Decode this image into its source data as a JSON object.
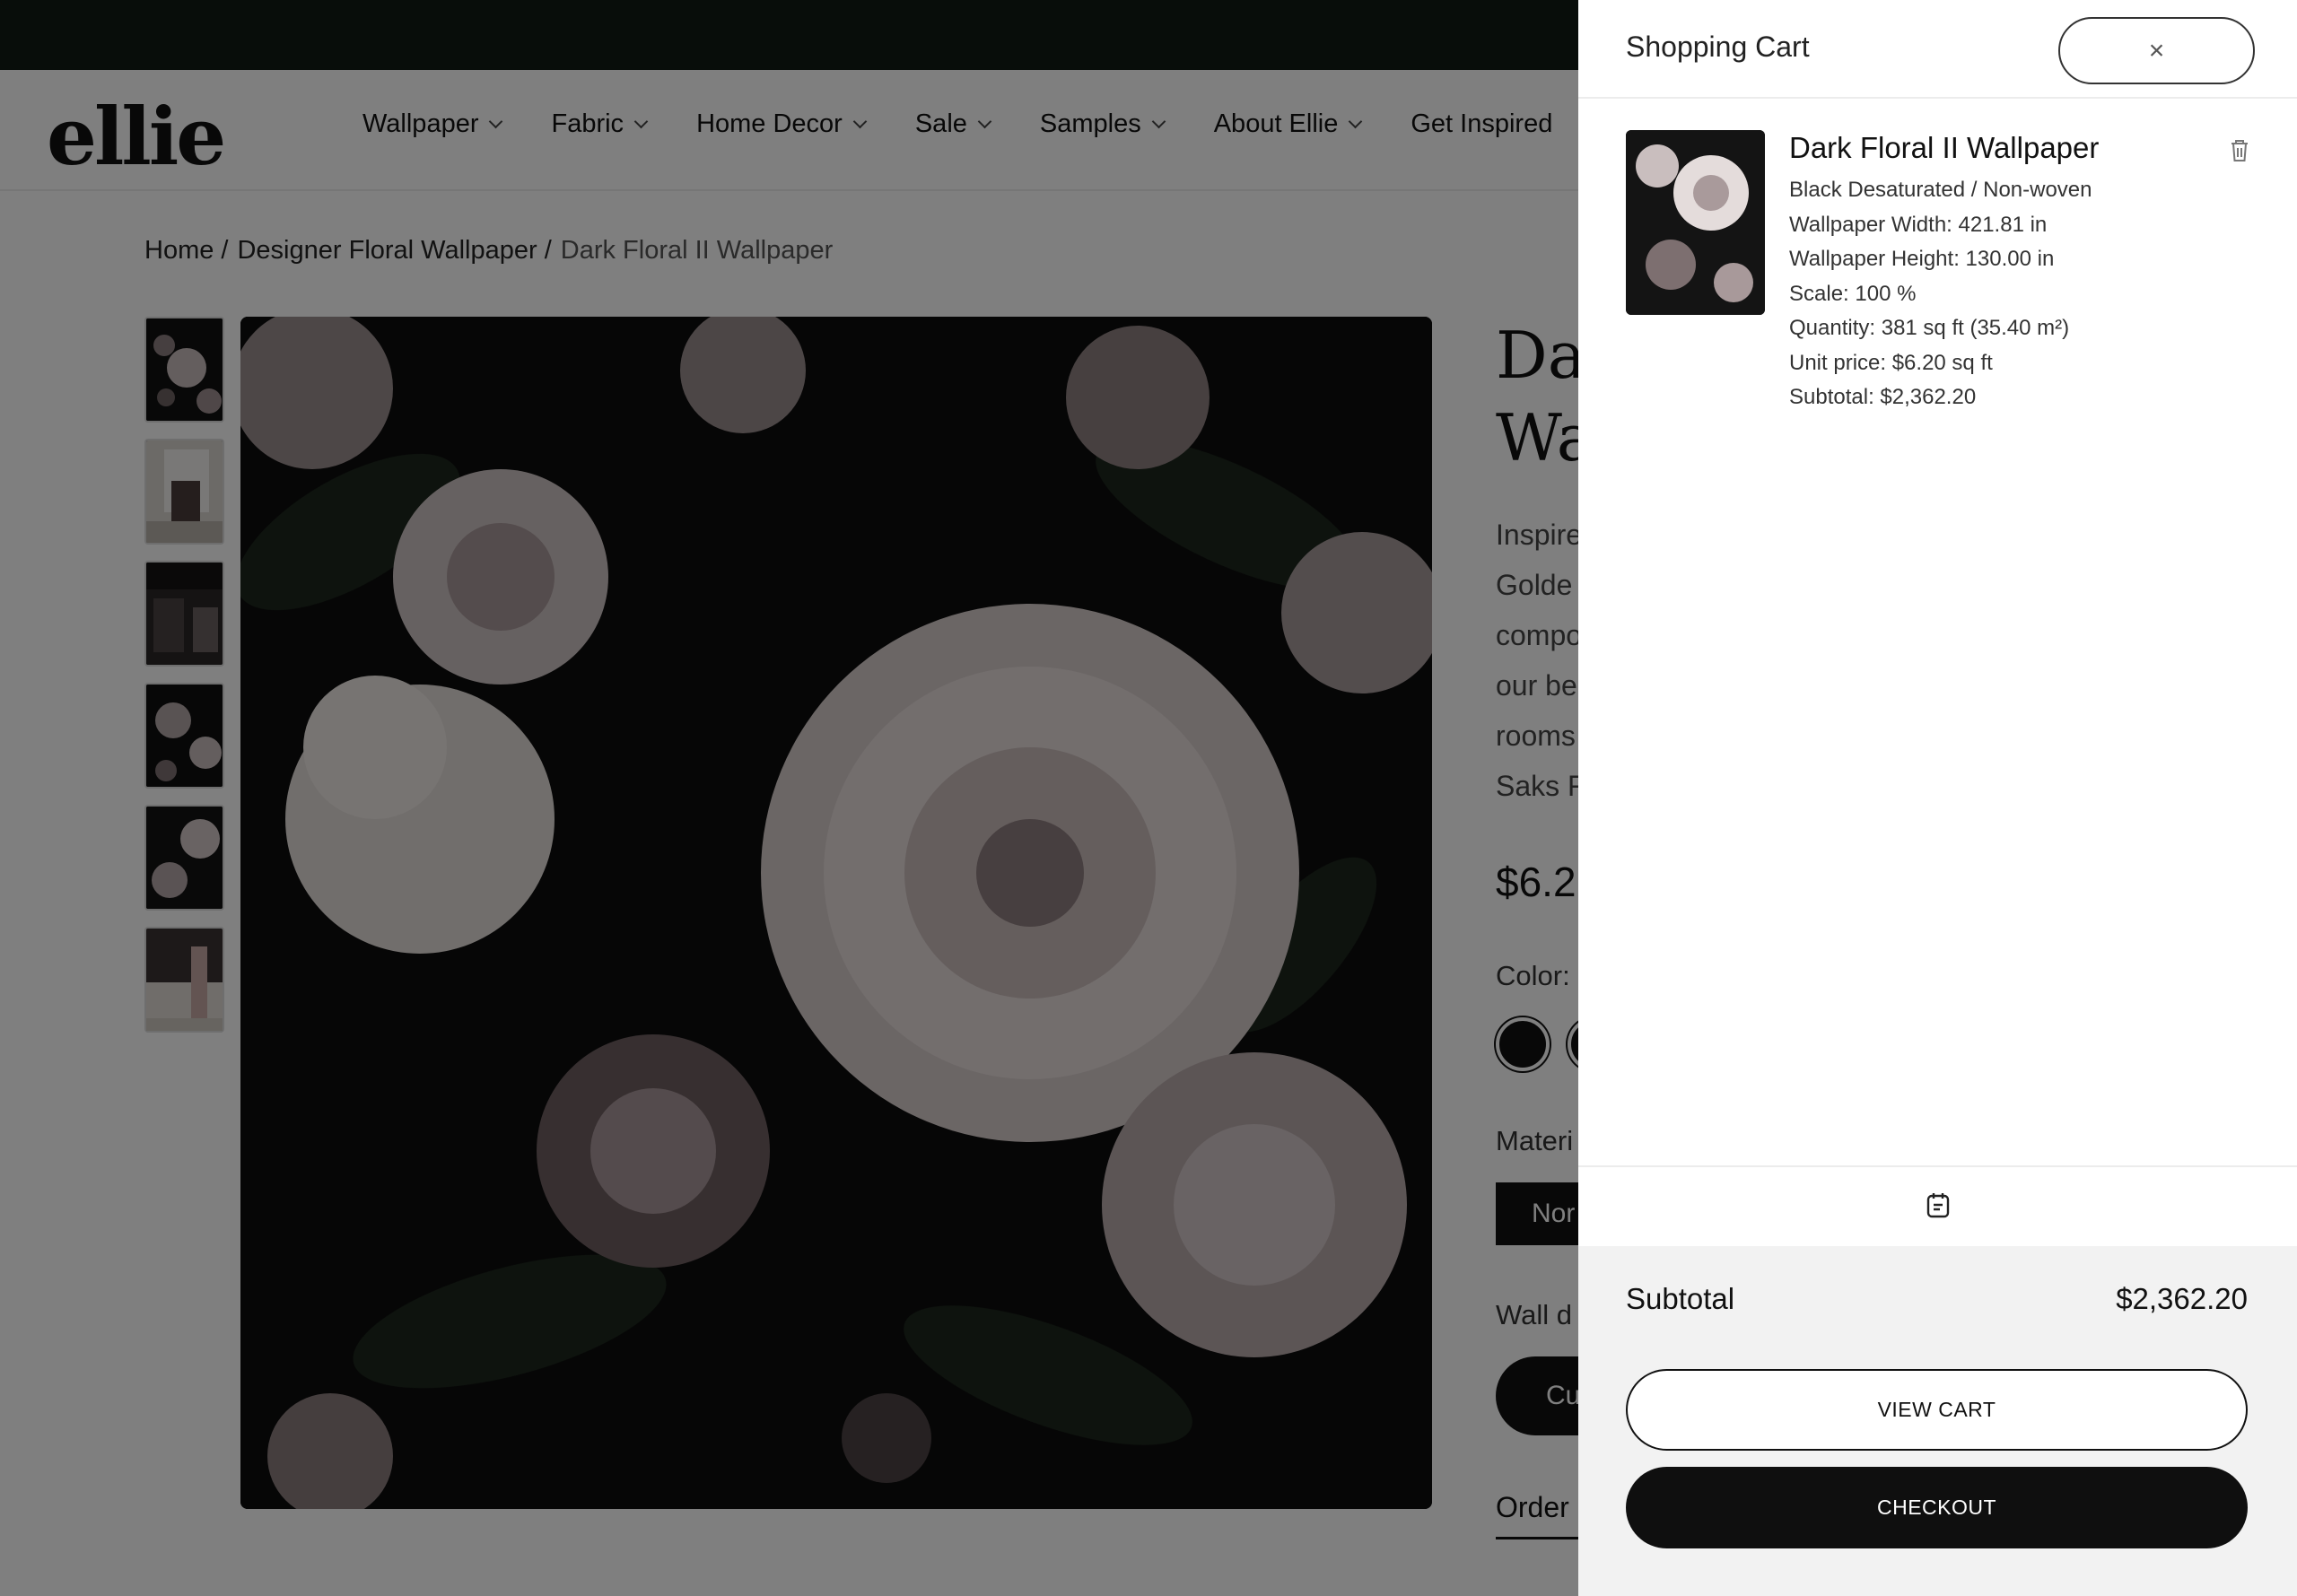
{
  "site": {
    "logo": "ellie",
    "nav": [
      {
        "label": "Wallpaper"
      },
      {
        "label": "Fabric"
      },
      {
        "label": "Home Decor"
      },
      {
        "label": "Sale"
      },
      {
        "label": "Samples"
      },
      {
        "label": "About Ellie"
      },
      {
        "label": "Get Inspired"
      }
    ]
  },
  "breadcrumb": {
    "home": "Home /",
    "category": "Designer Floral Wallpaper /",
    "current": "Dark Floral II Wallpaper"
  },
  "product": {
    "title_line1": "Da",
    "title_line2": "Wa",
    "desc_lines": [
      "Inspire",
      "Golde",
      "compo",
      "our be",
      "rooms",
      "Saks F"
    ],
    "price": "$6.2",
    "color_label": "Color:",
    "material_label": "Materi",
    "material_button": "Nor",
    "wall_label": "Wall d",
    "custom_button": "Cu",
    "order_tab": "Order"
  },
  "cart": {
    "title": "Shopping Cart",
    "close_symbol": "×",
    "item": {
      "name": "Dark Floral II Wallpaper",
      "variant": "Black Desaturated / Non-woven",
      "width": "Wallpaper Width: 421.81 in",
      "height": "Wallpaper Height: 130.00 in",
      "scale": "Scale: 100 %",
      "quantity": "Quantity: 381 sq ft (35.40 m²)",
      "unit_price": "Unit price: $6.20 sq ft",
      "subtotal": "Subtotal: $2,362.20"
    },
    "subtotal_label": "Subtotal",
    "subtotal_value": "$2,362.20",
    "view_cart": "VIEW CART",
    "checkout": "CHECKOUT"
  },
  "colors": {
    "topbar": "#111a14",
    "overlay": "rgba(0,0,0,0.5)",
    "button_dark": "#0f0f0f",
    "footer_bg": "#f2f2f2"
  },
  "icons": {
    "close": "close-icon",
    "trash": "trash-icon",
    "note": "note-icon",
    "chevron": "chevron-down-icon"
  }
}
